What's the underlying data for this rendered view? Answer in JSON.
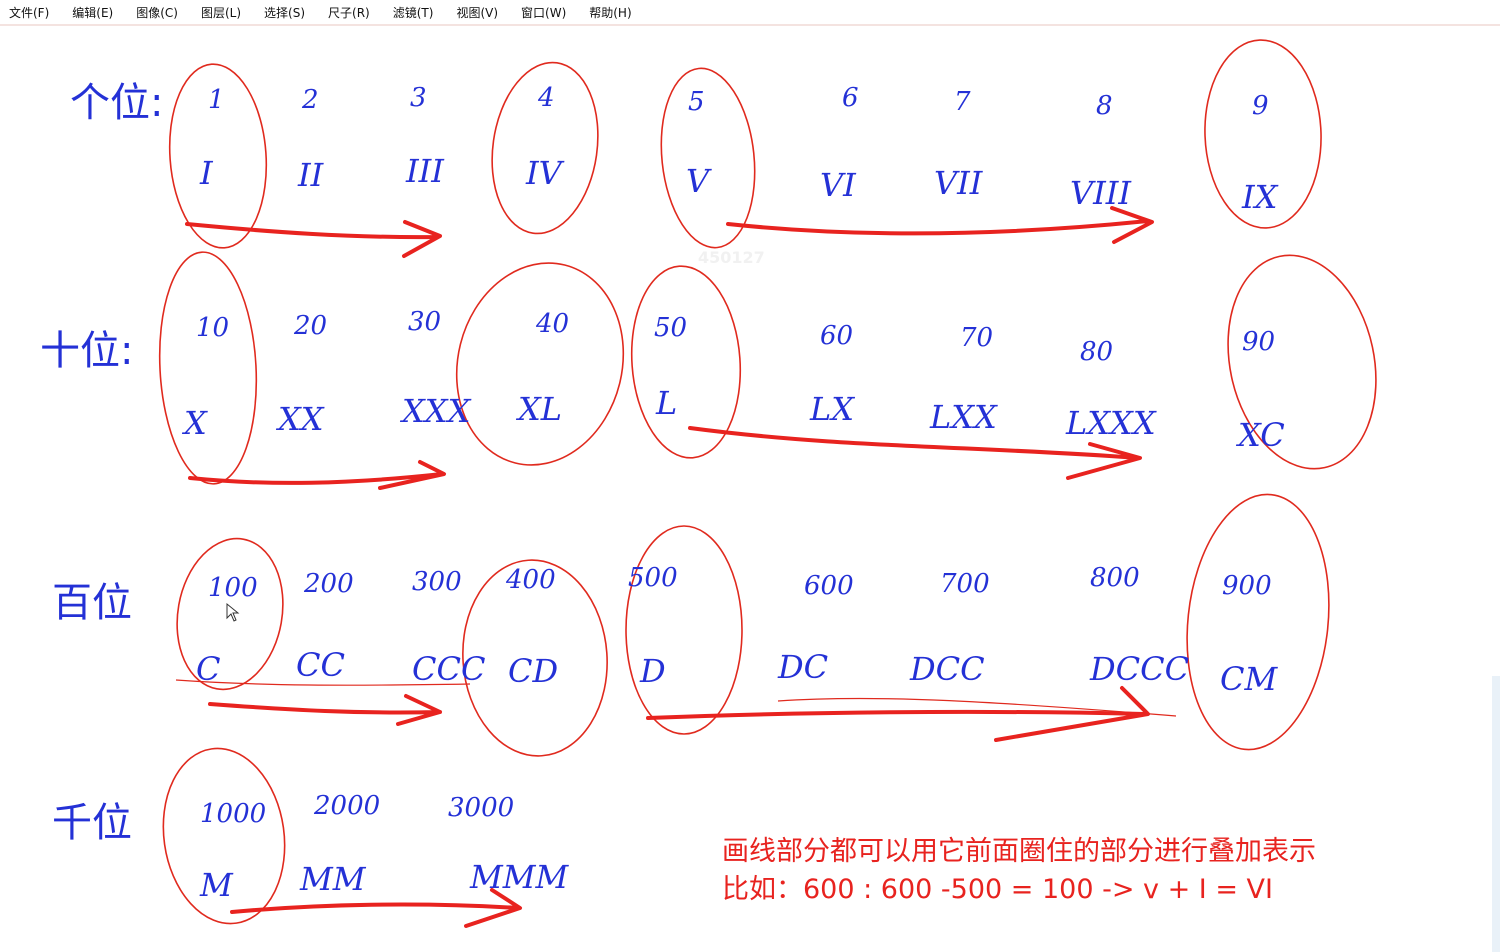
{
  "menu": {
    "items": [
      "文件(F)",
      "编辑(E)",
      "图像(C)",
      "图层(L)",
      "选择(S)",
      "尺子(R)",
      "滤镜(T)",
      "视图(V)",
      "窗口(W)",
      "帮助(H)"
    ]
  },
  "watermark": "450127",
  "rows": [
    {
      "label": "个位:",
      "digits": [
        "1",
        "2",
        "3",
        "4",
        "5",
        "6",
        "7",
        "8",
        "9"
      ],
      "romans": [
        "I",
        "II",
        "III",
        "IV",
        "V",
        "VI",
        "VII",
        "VIII",
        "IX"
      ]
    },
    {
      "label": "十位:",
      "digits": [
        "10",
        "20",
        "30",
        "40",
        "50",
        "60",
        "70",
        "80",
        "90"
      ],
      "romans": [
        "X",
        "XX",
        "XXX",
        "XL",
        "L",
        "LX",
        "LXX",
        "LXXX",
        "XC"
      ]
    },
    {
      "label": "百位",
      "digits": [
        "100",
        "200",
        "300",
        "400",
        "500",
        "600",
        "700",
        "800",
        "900"
      ],
      "romans": [
        "C",
        "CC",
        "CCC",
        "CD",
        "D",
        "DC",
        "DCC",
        "DCCC",
        "CM"
      ]
    },
    {
      "label": "千位",
      "digits": [
        "1000",
        "2000",
        "3000"
      ],
      "romans": [
        "M",
        "MM",
        "MMM"
      ]
    }
  ],
  "note": {
    "line1": "画线部分都可以用它前面圈住的部分进行叠加表示",
    "line2": "比如：600 :   600 -500 = 100  ->  v + I = VI"
  },
  "colors": {
    "ink_blue": "#2431d6",
    "ink_red": "#e8231f",
    "accent_red": "#e02a1e"
  }
}
